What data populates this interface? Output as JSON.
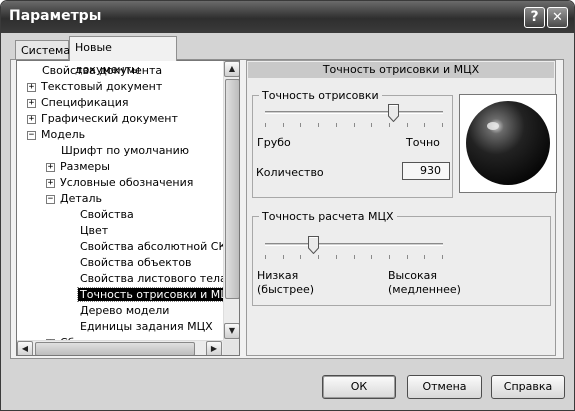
{
  "window": {
    "title": "Параметры",
    "help_button": "?",
    "close_button": "✕"
  },
  "tabs": [
    {
      "label": "Система",
      "active": false
    },
    {
      "label": "Новые документы",
      "active": true
    }
  ],
  "tree": {
    "items": [
      {
        "label": "Свойства документа",
        "expander": ""
      },
      {
        "label": "Текстовый документ",
        "expander": "+"
      },
      {
        "label": "Спецификация",
        "expander": "+"
      },
      {
        "label": "Графический документ",
        "expander": "+"
      },
      {
        "label": "Модель",
        "expander": "−"
      },
      {
        "label": "Шрифт по умолчанию",
        "expander": ""
      },
      {
        "label": "Размеры",
        "expander": "+"
      },
      {
        "label": "Условные обозначения",
        "expander": "+"
      },
      {
        "label": "Деталь",
        "expander": "−"
      },
      {
        "label": "Свойства",
        "expander": ""
      },
      {
        "label": "Цвет",
        "expander": ""
      },
      {
        "label": "Свойства абсолютной СК",
        "expander": ""
      },
      {
        "label": "Свойства объектов",
        "expander": ""
      },
      {
        "label": "Свойства листового тела",
        "expander": ""
      },
      {
        "label": "Точность отрисовки и МЦХ",
        "expander": "",
        "selected": true
      },
      {
        "label": "Дерево модели",
        "expander": ""
      },
      {
        "label": "Единицы задания МЦХ",
        "expander": ""
      },
      {
        "label": "Сборка",
        "expander": "+"
      }
    ],
    "scroll_up": "▲",
    "scroll_down": "▼",
    "scroll_left": "◀",
    "scroll_right": "▶"
  },
  "panel": {
    "header": "Точность отрисовки и МЦХ",
    "render_group": {
      "title": "Точность отрисовки",
      "min_label": "Грубо",
      "max_label": "Точно",
      "slider_position": 0.72,
      "count_label": "Количество",
      "count_value": "930"
    },
    "mcx_group": {
      "title": "Точность расчета МЦХ",
      "min_label": "Низкая\n(быстрее)",
      "max_label": "Высокая\n(медленнее)",
      "min_line1": "Низкая",
      "min_line2": "(быстрее)",
      "max_line1": "Высокая",
      "max_line2": "(медленнее)",
      "slider_position": 0.27
    }
  },
  "buttons": {
    "ok": "ОК",
    "cancel": "Отмена",
    "help": "Справка"
  }
}
